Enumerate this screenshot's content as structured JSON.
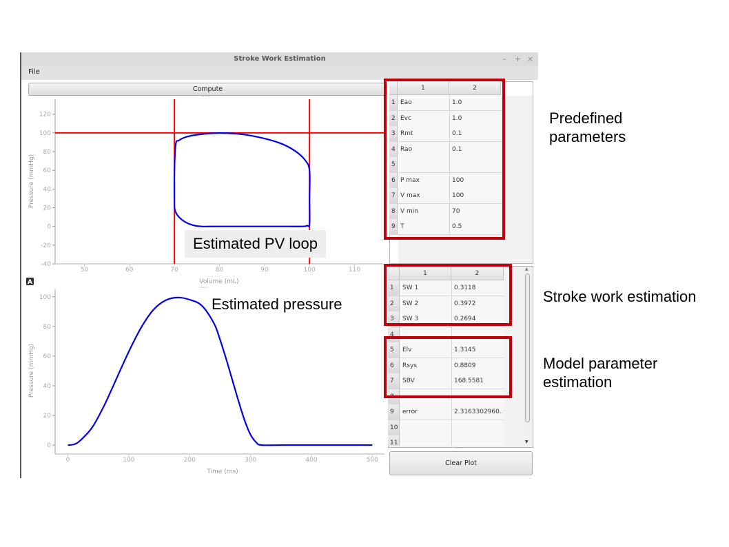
{
  "window": {
    "title": "Stroke Work Estimation",
    "controls": {
      "minimize": "–",
      "maximize": "+",
      "close": "×"
    }
  },
  "menubar": {
    "items": [
      "File"
    ]
  },
  "toolbar": {
    "compute_label": "Compute",
    "clear_plot_label": "Clear Plot"
  },
  "a_badge": "A",
  "predefined_table": {
    "columns": [
      "1",
      "2"
    ],
    "rows": [
      {
        "index": "1",
        "name": "Eao",
        "value": "1.0"
      },
      {
        "index": "2",
        "name": "Evc",
        "value": "1.0"
      },
      {
        "index": "3",
        "name": "Rmt",
        "value": "0.1"
      },
      {
        "index": "4",
        "name": "Rao",
        "value": "0.1"
      },
      {
        "index": "5",
        "name": "",
        "value": ""
      },
      {
        "index": "6",
        "name": "P max",
        "value": "100"
      },
      {
        "index": "7",
        "name": "V max",
        "value": "100"
      },
      {
        "index": "8",
        "name": "V min",
        "value": "70"
      },
      {
        "index": "9",
        "name": "T",
        "value": "0.5"
      }
    ]
  },
  "results_table": {
    "columns": [
      "1",
      "2"
    ],
    "rows": [
      {
        "index": "1",
        "name": "SW 1",
        "value": "0.3118"
      },
      {
        "index": "2",
        "name": "SW 2",
        "value": "0.3972"
      },
      {
        "index": "3",
        "name": "SW 3",
        "value": "0.2694"
      },
      {
        "index": "4",
        "name": "",
        "value": ""
      },
      {
        "index": "5",
        "name": "Elv",
        "value": "1.3145"
      },
      {
        "index": "6",
        "name": "Rsys",
        "value": "0.8809"
      },
      {
        "index": "7",
        "name": "SBV",
        "value": "168.5581"
      },
      {
        "index": "8",
        "name": "",
        "value": ""
      },
      {
        "index": "9",
        "name": "error",
        "value": "2.3163302960..."
      },
      {
        "index": "10",
        "name": "",
        "value": ""
      },
      {
        "index": "11",
        "name": "",
        "value": ""
      }
    ]
  },
  "annotations": {
    "pv_loop": "Estimated PV loop",
    "pressure": "Estimated pressure",
    "predefined": [
      "Predefined",
      "parameters"
    ],
    "stroke_work": "Stroke work estimation",
    "model_param": [
      "Model parameter",
      "estimation"
    ]
  },
  "colors": {
    "curve": "#0000ee",
    "marker_lines": "#ff0000",
    "highlight_box": "#c0000b"
  },
  "chart_data": [
    {
      "type": "line",
      "title": "",
      "xlabel": "Volume (mL)",
      "ylabel": "Pressure (mmHg)",
      "xlim": [
        43.5,
        116.5
      ],
      "ylim": [
        -40,
        136
      ],
      "xticks": [
        50,
        60,
        70,
        80,
        90,
        100,
        110
      ],
      "yticks": [
        -40,
        -20,
        0,
        20,
        40,
        60,
        80,
        100,
        120
      ],
      "grid": false,
      "reference_lines": {
        "vertical": [
          70,
          100
        ],
        "horizontal": [
          100
        ]
      },
      "series": [
        {
          "name": "PV loop",
          "x": [
            70,
            70,
            70.3,
            71,
            72.5,
            75,
            80,
            85,
            90,
            94,
            97,
            99,
            100,
            100,
            100,
            99.4,
            98.5,
            95,
            90,
            80,
            76,
            74,
            72.3,
            71,
            70.3,
            70
          ],
          "y": [
            20,
            60,
            88,
            92,
            95.5,
            98,
            99.8,
            98.5,
            94,
            88,
            80,
            71,
            60,
            30,
            3,
            0.8,
            0,
            0,
            0,
            0,
            0,
            1.5,
            5,
            10,
            15,
            20
          ]
        }
      ]
    },
    {
      "type": "line",
      "title": "",
      "xlabel": "Time (ms)",
      "ylabel": "Pressure (mmHg)",
      "xlim": [
        -21,
        520
      ],
      "ylim": [
        -6,
        105
      ],
      "xticks": [
        0,
        100,
        200,
        300,
        400,
        500
      ],
      "yticks": [
        0,
        20,
        40,
        60,
        80,
        100
      ],
      "grid": false,
      "series": [
        {
          "name": "Pressure",
          "x": [
            0,
            10,
            20,
            40,
            60,
            80,
            100,
            120,
            140,
            160,
            180,
            200,
            220,
            240,
            250,
            260,
            270,
            280,
            290,
            300,
            310,
            318,
            350,
            400,
            450,
            500
          ],
          "y": [
            0,
            0.5,
            3,
            12,
            27,
            45,
            63,
            79,
            91,
            97.5,
            99.5,
            98,
            94,
            82,
            71,
            58,
            44,
            30,
            17,
            7,
            1.5,
            0,
            0,
            0,
            0,
            0
          ]
        }
      ]
    }
  ]
}
